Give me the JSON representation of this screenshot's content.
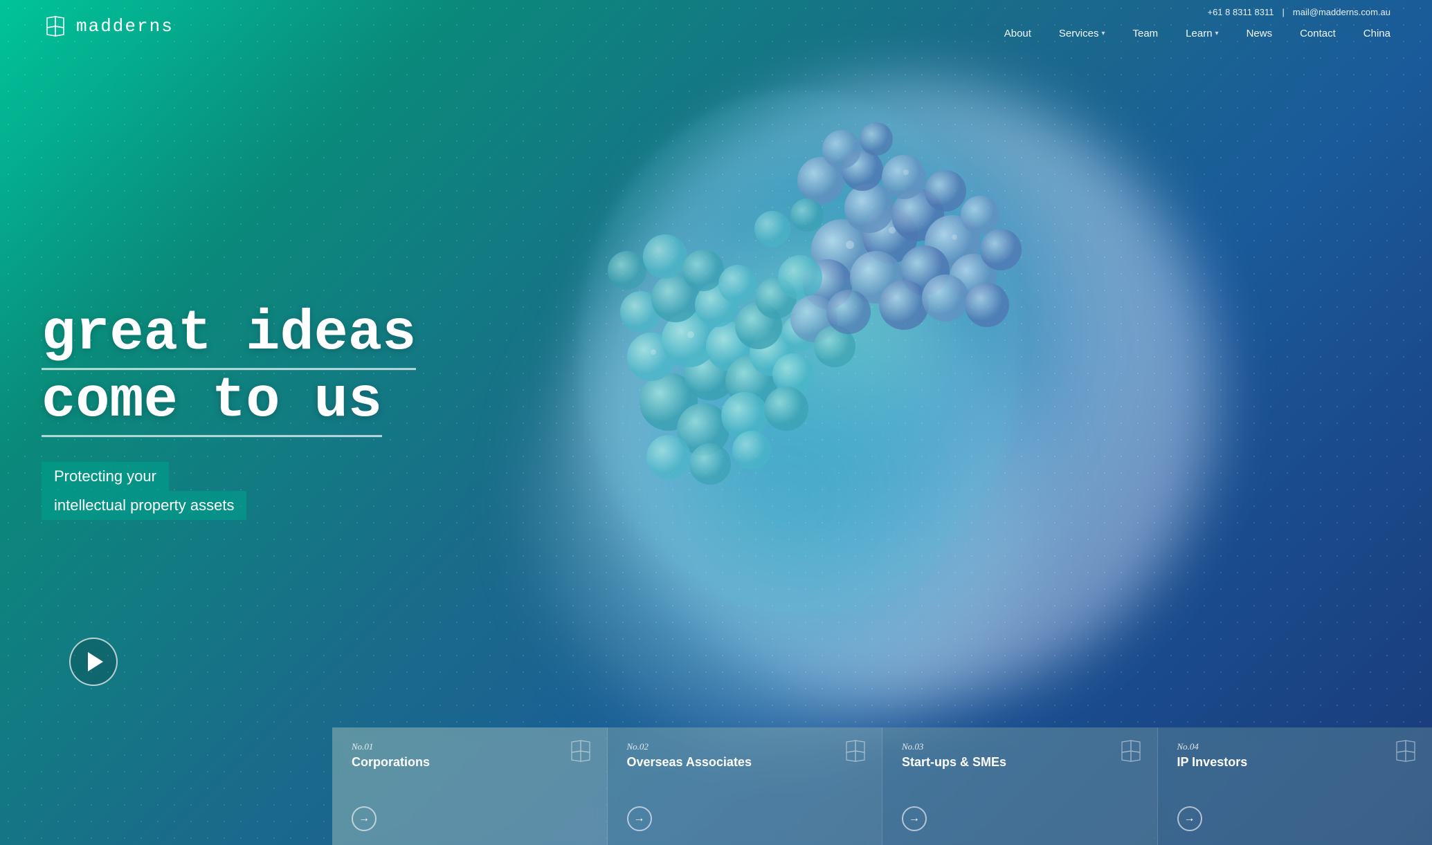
{
  "site": {
    "logo_text": "madderns",
    "phone": "+61 8 8311 8311",
    "email": "mail@madderns.com.au",
    "email_label": "mail@madderns.com.au",
    "divider": "|"
  },
  "nav": {
    "items": [
      {
        "label": "About",
        "has_dropdown": false
      },
      {
        "label": "Services",
        "has_dropdown": true
      },
      {
        "label": "Team",
        "has_dropdown": false
      },
      {
        "label": "Learn",
        "has_dropdown": true
      },
      {
        "label": "News",
        "has_dropdown": false
      },
      {
        "label": "Contact",
        "has_dropdown": false
      },
      {
        "label": "China",
        "has_dropdown": false
      }
    ]
  },
  "hero": {
    "headline_line1": "great ideas",
    "headline_line2": "come to us",
    "subtitle_line1": "Protecting your",
    "subtitle_line2": "intellectual property assets"
  },
  "cards": [
    {
      "number": "No.01",
      "title": "Corporations",
      "arrow": "→"
    },
    {
      "number": "No.02",
      "title": "Overseas Associates",
      "arrow": "→"
    },
    {
      "number": "No.03",
      "title": "Start-ups & SMEs",
      "arrow": "→"
    },
    {
      "number": "No.04",
      "title": "IP Investors",
      "arrow": "→"
    }
  ]
}
